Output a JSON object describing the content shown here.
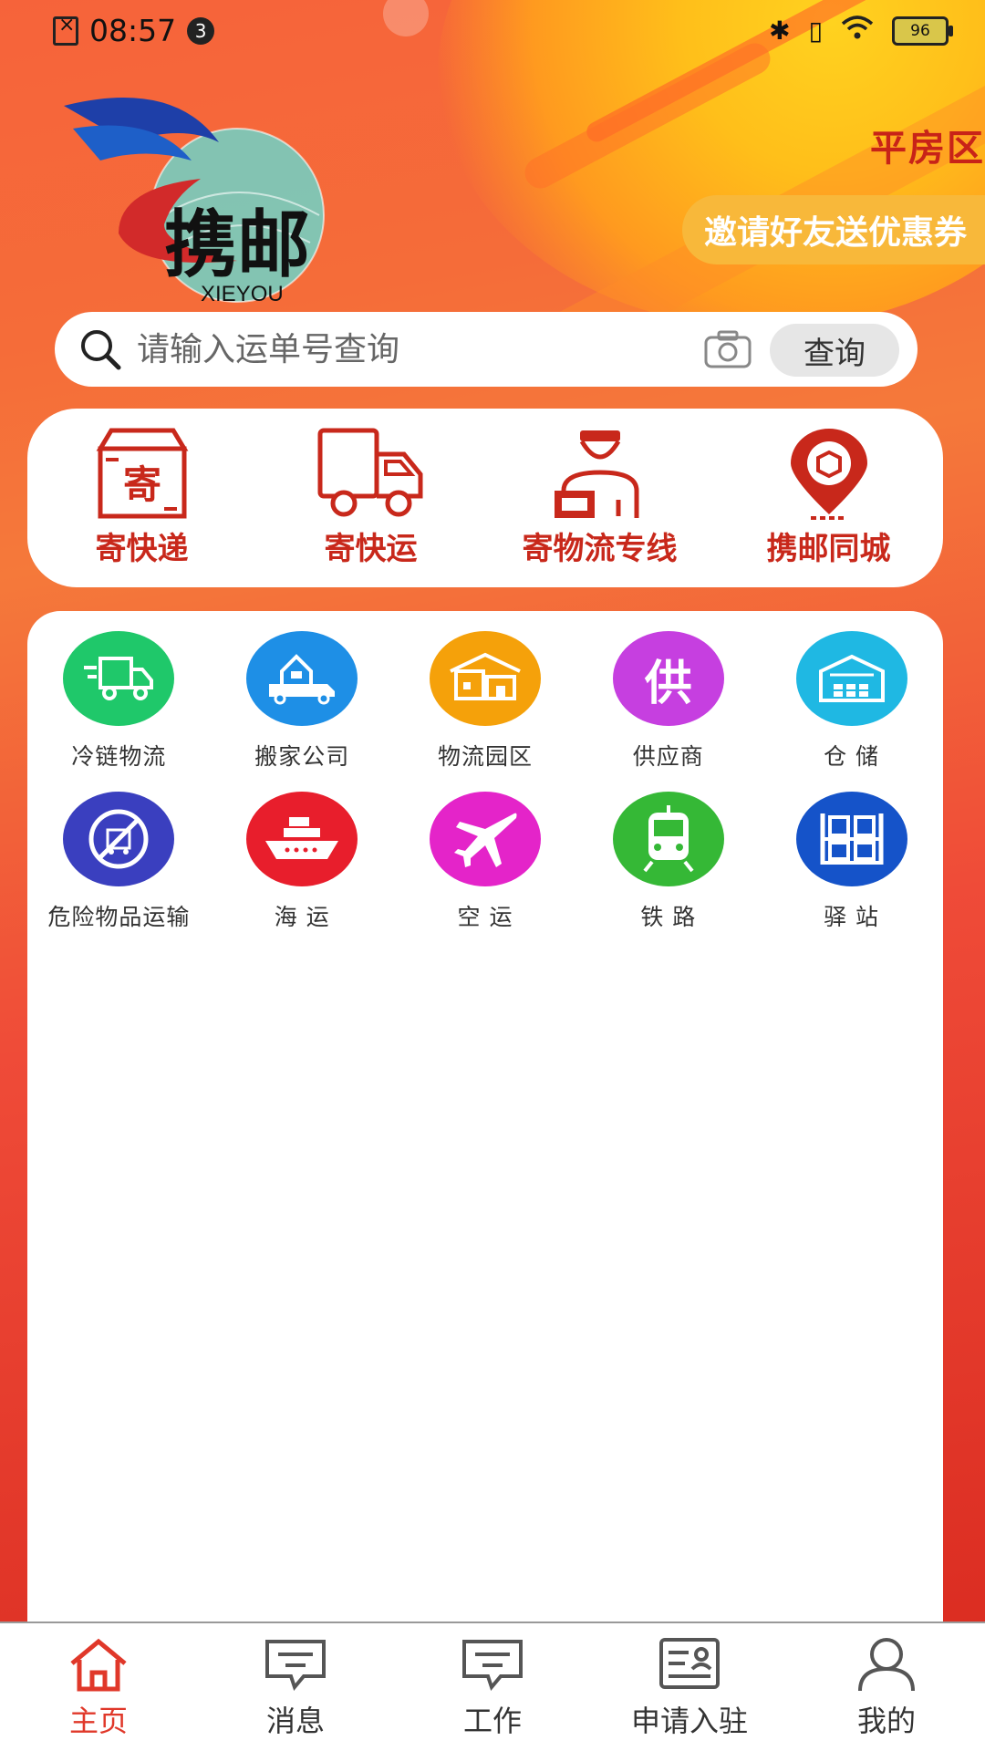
{
  "status_bar": {
    "time": "08:57",
    "notification_count": "3",
    "battery": "96"
  },
  "header": {
    "logo_text": "携邮",
    "logo_subtext": "XIEYOU",
    "district": "平房区",
    "invite_label": "邀请好友送优惠券"
  },
  "search": {
    "placeholder": "请输入运单号查询",
    "button_label": "查询"
  },
  "services": [
    {
      "label": "寄快递",
      "icon": "box-icon"
    },
    {
      "label": "寄快运",
      "icon": "truck-icon"
    },
    {
      "label": "寄物流专线",
      "icon": "courier-icon"
    },
    {
      "label": "携邮同城",
      "icon": "location-pin-icon"
    }
  ],
  "features": [
    {
      "label": "冷链物流",
      "icon": "cold-chain-truck-icon",
      "color": "#1fc86a"
    },
    {
      "label": "搬家公司",
      "icon": "moving-truck-icon",
      "color": "#1e8fe6"
    },
    {
      "label": "物流园区",
      "icon": "warehouse-park-icon",
      "color": "#f5a10a"
    },
    {
      "label": "供应商",
      "icon": "supplier-icon",
      "color": "#c63fe0"
    },
    {
      "label": "仓 储",
      "icon": "storage-icon",
      "color": "#1fb8e3"
    },
    {
      "label": "危险物品运输",
      "icon": "hazard-transport-icon",
      "color": "#3a3fbf"
    },
    {
      "label": "海 运",
      "icon": "ship-icon",
      "color": "#e81e2c"
    },
    {
      "label": "空 运",
      "icon": "plane-icon",
      "color": "#e424c9"
    },
    {
      "label": "铁 路",
      "icon": "train-icon",
      "color": "#35b836"
    },
    {
      "label": "驿 站",
      "icon": "station-icon",
      "color": "#1553c9"
    }
  ],
  "nav": [
    {
      "label": "主页",
      "icon": "home-icon",
      "active": true
    },
    {
      "label": "消息",
      "icon": "message-icon",
      "active": false
    },
    {
      "label": "工作",
      "icon": "work-icon",
      "active": false
    },
    {
      "label": "申请入驻",
      "icon": "apply-icon",
      "active": false
    },
    {
      "label": "我的",
      "icon": "user-icon",
      "active": false
    }
  ],
  "colors": {
    "brand_red": "#c8281b",
    "accent_orange": "#f8b83a",
    "nav_active": "#e0382a"
  }
}
